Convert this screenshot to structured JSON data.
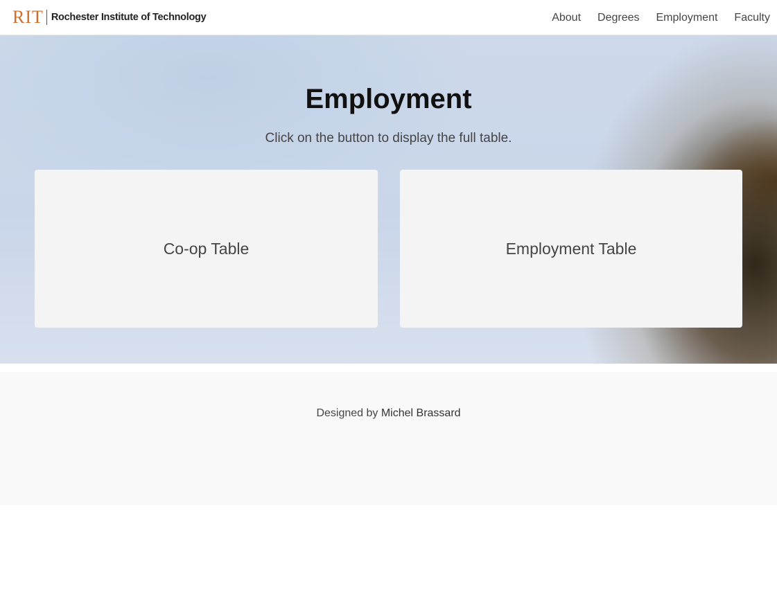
{
  "header": {
    "logo_mark": "RIT",
    "logo_text": "Rochester Institute of Technology",
    "nav": [
      {
        "label": "About"
      },
      {
        "label": "Degrees"
      },
      {
        "label": "Employment"
      },
      {
        "label": "Faculty"
      }
    ]
  },
  "hero": {
    "title": "Employment",
    "subtitle": "Click on the button to display the full table.",
    "cards": [
      {
        "label": "Co-op Table"
      },
      {
        "label": "Employment Table"
      }
    ]
  },
  "footer": {
    "prefix": "Designed by",
    "name": "Michel Brassard"
  },
  "colors": {
    "brand_orange": "#d16d2b",
    "card_bg": "#f4f4f4",
    "footer_bg": "#f9f9f9"
  }
}
